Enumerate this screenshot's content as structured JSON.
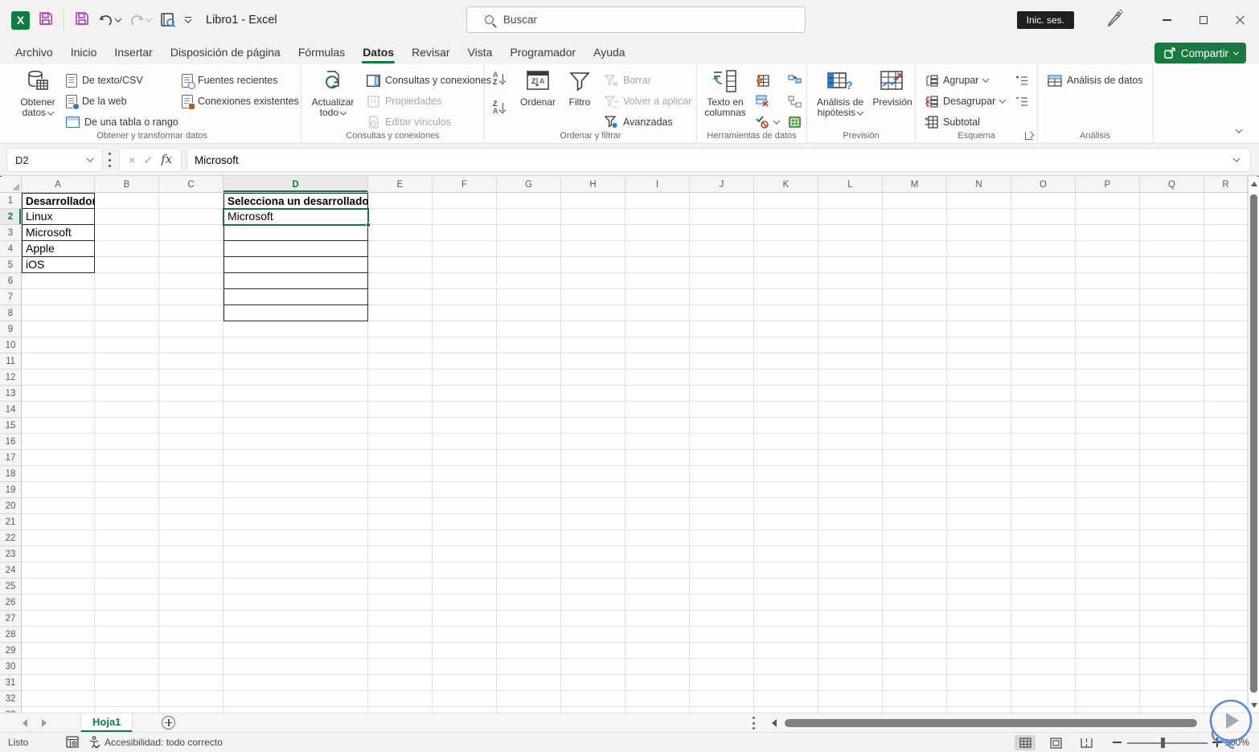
{
  "titlebar": {
    "app_title": "Libro1 - Excel",
    "search_placeholder": "Buscar",
    "sign_in_label": "Inic. ses."
  },
  "menu_tabs": {
    "items": [
      {
        "label": "Archivo",
        "active": false
      },
      {
        "label": "Inicio",
        "active": false
      },
      {
        "label": "Insertar",
        "active": false
      },
      {
        "label": "Disposición de página",
        "active": false
      },
      {
        "label": "Fórmulas",
        "active": false
      },
      {
        "label": "Datos",
        "active": true
      },
      {
        "label": "Revisar",
        "active": false
      },
      {
        "label": "Vista",
        "active": false
      },
      {
        "label": "Programador",
        "active": false
      },
      {
        "label": "Ayuda",
        "active": false
      }
    ],
    "share_label": "Compartir"
  },
  "ribbon": {
    "get_transform": {
      "label": "Obtener y transformar datos",
      "get_data": "Obtener datos",
      "from_text_csv": "De texto/CSV",
      "from_web": "De la web",
      "from_table_range": "De una tabla o rango",
      "recent_sources": "Fuentes recientes",
      "existing_connections": "Conexiones existentes"
    },
    "queries_connections": {
      "label": "Consultas y conexiones",
      "refresh_all": "Actualizar todo",
      "queries_item": "Consultas y conexiones",
      "properties": "Propiedades",
      "edit_links": "Editar vínculos"
    },
    "sort_filter": {
      "label": "Ordenar y filtrar",
      "sort": "Ordenar",
      "filter": "Filtro",
      "clear": "Borrar",
      "reapply": "Volver a aplicar",
      "advanced": "Avanzadas"
    },
    "data_tools": {
      "label": "Herramientas de datos",
      "text_to_columns": "Texto en columnas"
    },
    "forecast": {
      "label": "Previsión",
      "what_if": "Análisis de hipótesis",
      "forecast_sheet": "Previsión"
    },
    "outline": {
      "label": "Esquema",
      "group": "Agrupar",
      "ungroup": "Desagrupar",
      "subtotal": "Subtotal"
    },
    "analysis": {
      "label": "Análisis",
      "data_analysis": "Análisis de datos"
    }
  },
  "formula_bar": {
    "name_box": "D2",
    "value": "Microsoft",
    "fx": "fx"
  },
  "icons": {
    "sort_a": "A",
    "sort_z": "Z",
    "cancel": "×",
    "check": "✓",
    "excel_x": "X",
    "question": "?"
  },
  "grid": {
    "columns": [
      "A",
      "B",
      "C",
      "D",
      "E",
      "F",
      "G",
      "H",
      "I",
      "J",
      "K",
      "L",
      "M",
      "N",
      "O",
      "P",
      "Q",
      "R"
    ],
    "visible_rows": 32,
    "selected_cell": {
      "col": "D",
      "row": 2
    },
    "cells": [
      {
        "ref": "A1",
        "text": "Desarrollador",
        "bold": true,
        "bordered": true
      },
      {
        "ref": "A2",
        "text": "Linux",
        "bordered": true
      },
      {
        "ref": "A3",
        "text": "Microsoft",
        "bordered": true
      },
      {
        "ref": "A4",
        "text": "Apple",
        "bordered": true
      },
      {
        "ref": "A5",
        "text": "iOS",
        "bordered": true
      },
      {
        "ref": "D1",
        "text": "Selecciona un desarrollador",
        "bold": true,
        "bordered": true
      },
      {
        "ref": "D2",
        "text": "Microsoft",
        "bordered": true
      },
      {
        "ref": "D3",
        "text": "",
        "bordered": true
      },
      {
        "ref": "D4",
        "text": "",
        "bordered": true
      },
      {
        "ref": "D5",
        "text": "",
        "bordered": true
      },
      {
        "ref": "D6",
        "text": "",
        "bordered": true
      },
      {
        "ref": "D7",
        "text": "",
        "bordered": true
      },
      {
        "ref": "D8",
        "text": "",
        "bordered": true
      }
    ]
  },
  "sheet_bar": {
    "sheet_name": "Hoja1"
  },
  "status_bar": {
    "ready": "Listo",
    "accessibility": "Accesibilidad: todo correcto",
    "zoom": "100%"
  },
  "colors": {
    "excel_green": "#107c41",
    "selection_green": "#1e7145",
    "save_icon_purple": "#b73bbe",
    "share_button_green": "#187a41"
  }
}
